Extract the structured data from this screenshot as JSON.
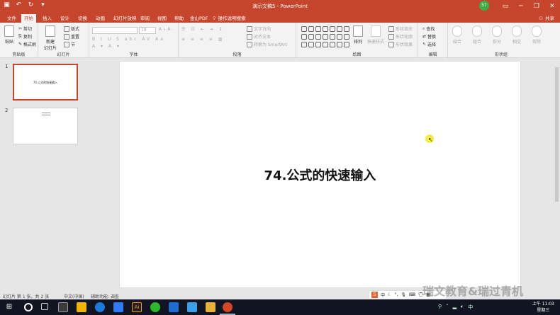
{
  "window": {
    "title": "演示文稿5  -  PowerPoint",
    "user_badge": "57"
  },
  "qat": {
    "save_icon": "save-icon",
    "undo_icon": "undo-icon",
    "redo_icon": "redo-icon",
    "customize_icon": "customize-icon"
  },
  "tabs": [
    {
      "label": "文件"
    },
    {
      "label": "开始"
    },
    {
      "label": "插入"
    },
    {
      "label": "设计"
    },
    {
      "label": "切换"
    },
    {
      "label": "动画"
    },
    {
      "label": "幻灯片放映"
    },
    {
      "label": "审阅"
    },
    {
      "label": "视图"
    },
    {
      "label": "帮助"
    },
    {
      "label": "金山PDF"
    }
  ],
  "tellme": {
    "label": "操作说明搜索"
  },
  "share": {
    "label": "共享"
  },
  "ribbon": {
    "clipboard": {
      "paste": "粘贴",
      "cut": "剪切",
      "copy": "复制",
      "format_painter": "格式刷",
      "group": "剪贴板"
    },
    "slides": {
      "new_slide": "新建\n幻灯片",
      "layout": "版式",
      "reset": "重置",
      "section": "节",
      "group": "幻灯片"
    },
    "font": {
      "size": "18",
      "group": "字体"
    },
    "paragraph": {
      "text_direction": "文字方向",
      "align_text": "对齐文本",
      "smartart": "转换为 SmartArt",
      "group": "段落"
    },
    "drawing": {
      "arrange": "排列",
      "quick_styles": "快速样式",
      "shape_fill": "形状填充",
      "shape_outline": "形状轮廓",
      "shape_effects": "形状效果",
      "group": "绘图"
    },
    "editing": {
      "find": "查找",
      "replace": "替换",
      "select": "选择",
      "group": "编辑"
    },
    "shape_comb": {
      "merge": "结合",
      "combine": "组合",
      "split": "拆分",
      "intersect": "相交",
      "subtract": "剪除",
      "group": "形状组"
    }
  },
  "thumbnails": [
    {
      "num": "1",
      "text": "74.公式的快速输入"
    },
    {
      "num": "2",
      "text": ""
    }
  ],
  "slide": {
    "title": "74.公式的快速输入"
  },
  "statusbar": {
    "slide_info": "幻灯片 第 1 张，共 2 张",
    "language": "中文(中国)",
    "accessibility": "辅助功能: 调查"
  },
  "ime": {
    "logo": "S",
    "mode": "中"
  },
  "watermark": "瑞文教育&瑞过青机",
  "taskbar": {
    "time": "上午 11:03",
    "day": "星期三"
  }
}
